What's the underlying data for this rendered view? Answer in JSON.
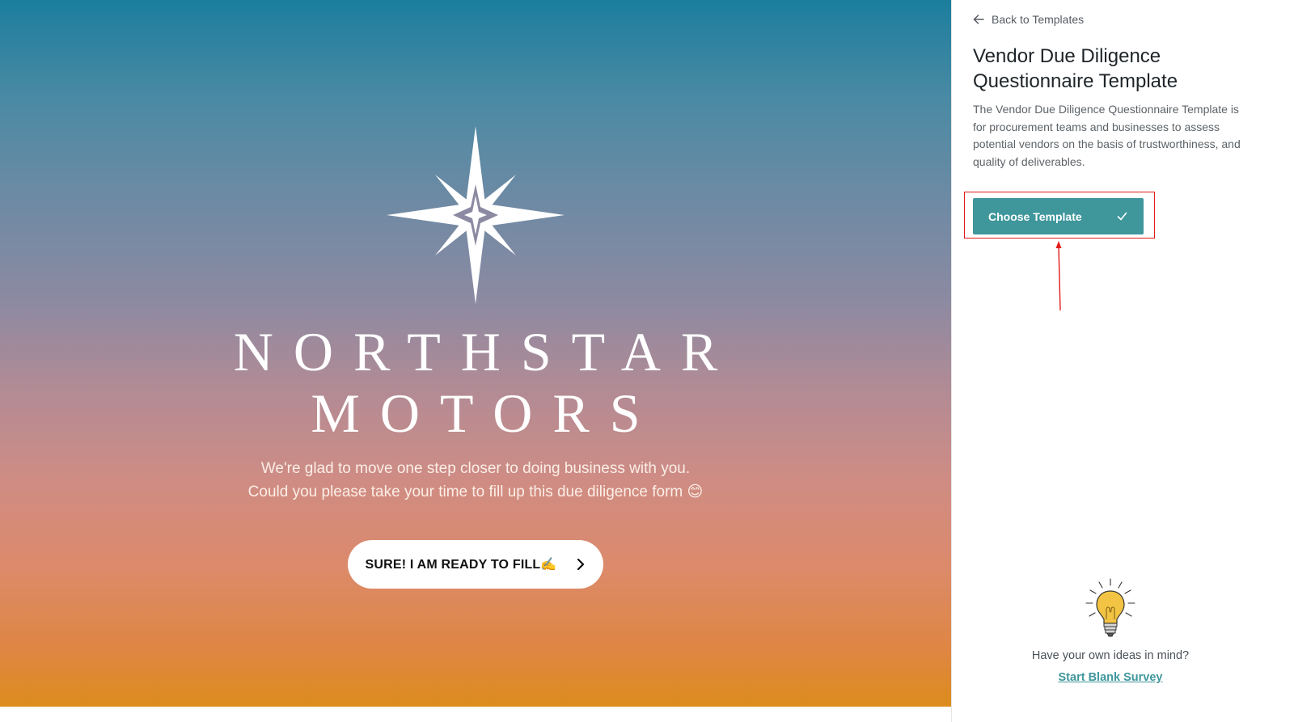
{
  "preview": {
    "brand_line_1": "NORTHSTAR",
    "brand_line_2": "MOTORS",
    "welcome_line_1": "We're glad to move one step closer to doing business with you.",
    "welcome_line_2": "Could you please take your time to fill up this due diligence form 😊",
    "ready_button_label": "SURE! I AM READY TO FILL✍️",
    "logo_icon": "north-star-icon",
    "button_icon": "chevron-right-icon"
  },
  "panel": {
    "back_label": "Back to Templates",
    "back_icon": "arrow-left-icon",
    "title": "Vendor Due Diligence Questionnaire Template",
    "description": "The Vendor Due Diligence Questionnaire Template is for procurement teams and businesses to assess potential vendors on the basis of trustworthiness, and quality of deliverables.",
    "choose_button_label": "Choose Template",
    "choose_button_icon": "check-icon",
    "ideas_prompt": "Have your own ideas in mind?",
    "blank_survey_link": "Start Blank Survey",
    "ideas_icon": "lightbulb-icon"
  },
  "colors": {
    "accent": "#3f979c",
    "annotation": "#e21b1b",
    "gradient_top": "#1b7e9d",
    "gradient_bottom": "#dc8c1c"
  }
}
